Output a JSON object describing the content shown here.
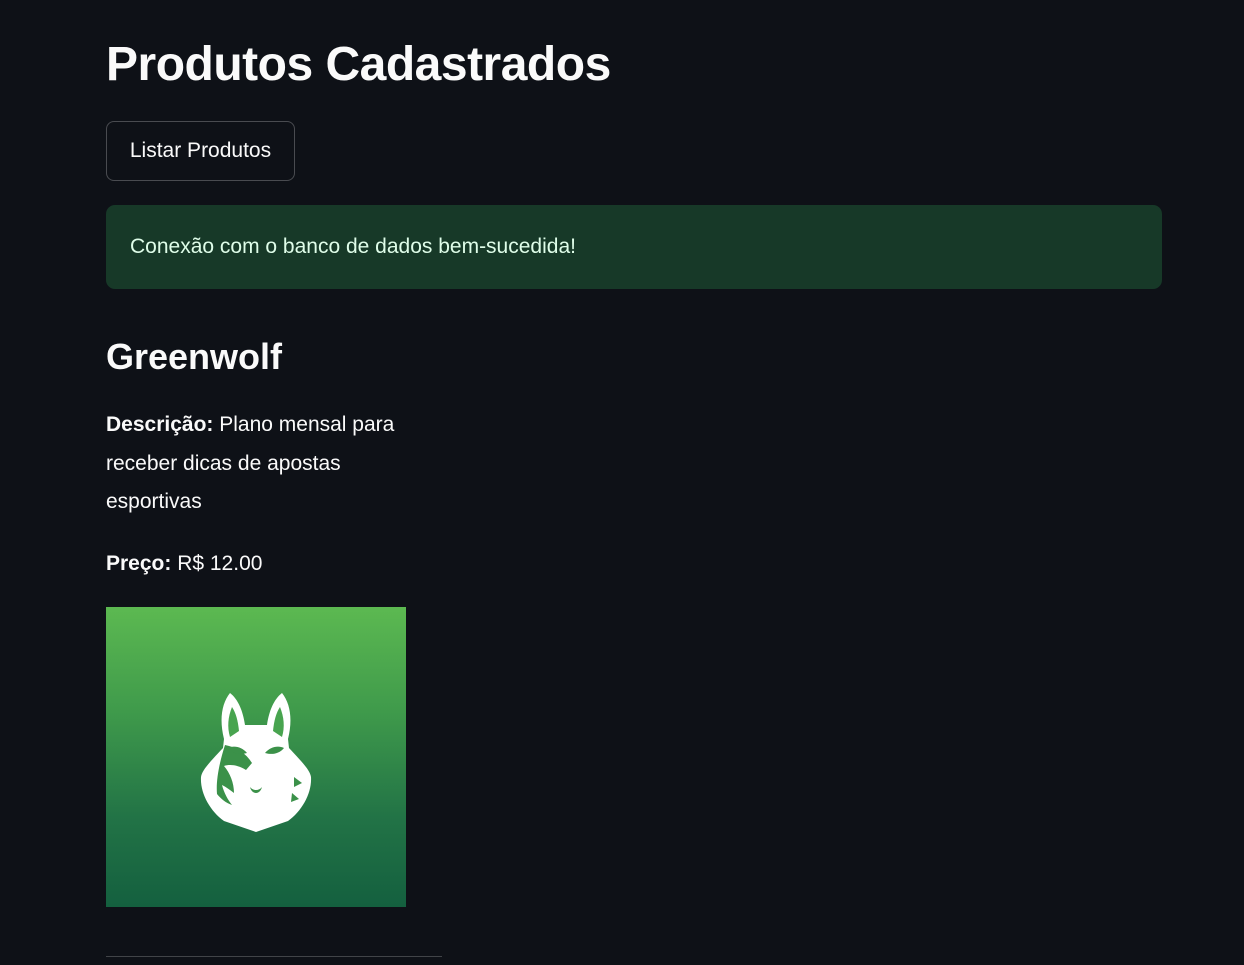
{
  "page": {
    "title": "Produtos Cadastrados"
  },
  "actions": {
    "list_button_label": "Listar Produtos"
  },
  "status": {
    "message": "Conexão com o banco de dados bem-sucedida!",
    "color": "#173928"
  },
  "product": {
    "name": "Greenwolf",
    "description_label": "Descrição:",
    "description": "Plano mensal para receber dicas de apostas esportivas",
    "price_label": "Preço:",
    "price": "R$ 12.00",
    "image_icon": "wolf-head-logo"
  },
  "theme": {
    "background": "#0e1117",
    "text": "#fafafa",
    "image_gradient_top": "#5cb951",
    "image_gradient_bottom": "#14603f"
  }
}
